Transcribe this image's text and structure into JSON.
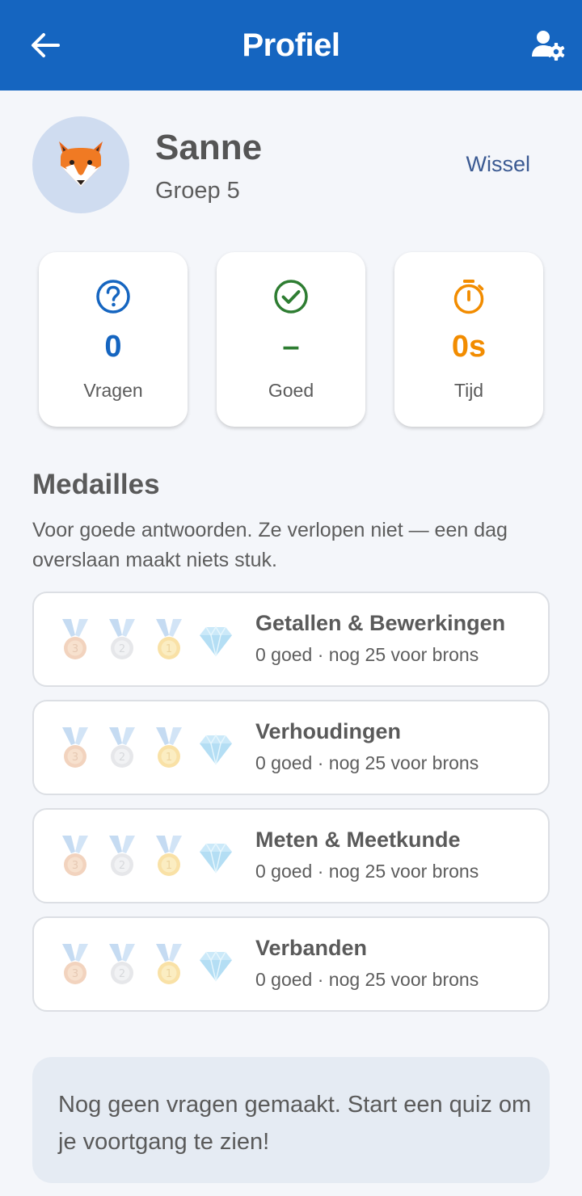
{
  "header": {
    "title": "Profiel",
    "back_icon": "arrow-left-icon",
    "settings_icon": "user-settings-icon",
    "background": "#1565c0"
  },
  "profile": {
    "avatar_icon": "fox-icon",
    "name": "Sanne",
    "group": "Groep 5",
    "switch_label": "Wissel"
  },
  "stats": [
    {
      "icon": "question-circle-icon",
      "value": "0",
      "label": "Vragen",
      "color": "#1565c0"
    },
    {
      "icon": "check-circle-icon",
      "value": "–",
      "label": "Goed",
      "color": "#2e7d32"
    },
    {
      "icon": "stopwatch-icon",
      "value": "0s",
      "label": "Tijd",
      "color": "#f28c00"
    }
  ],
  "medals": {
    "title": "Medailles",
    "description": "Voor goede antwoorden. Ze verlopen niet — een dag overslaan maakt niets stuk.",
    "medal_icons": [
      "bronze-medal-icon",
      "silver-medal-icon",
      "gold-medal-icon",
      "diamond-icon"
    ],
    "items": [
      {
        "title": "Getallen & Bewerkingen",
        "subtitle": "0 goed · nog 25 voor brons"
      },
      {
        "title": "Verhoudingen",
        "subtitle": "0 goed · nog 25 voor brons"
      },
      {
        "title": "Meten & Meetkunde",
        "subtitle": "0 goed · nog 25 voor brons"
      },
      {
        "title": "Verbanden",
        "subtitle": "0 goed · nog 25 voor brons"
      }
    ]
  },
  "notice": {
    "text": "Nog geen vragen gemaakt. Start een quiz om je voortgang te zien!"
  }
}
